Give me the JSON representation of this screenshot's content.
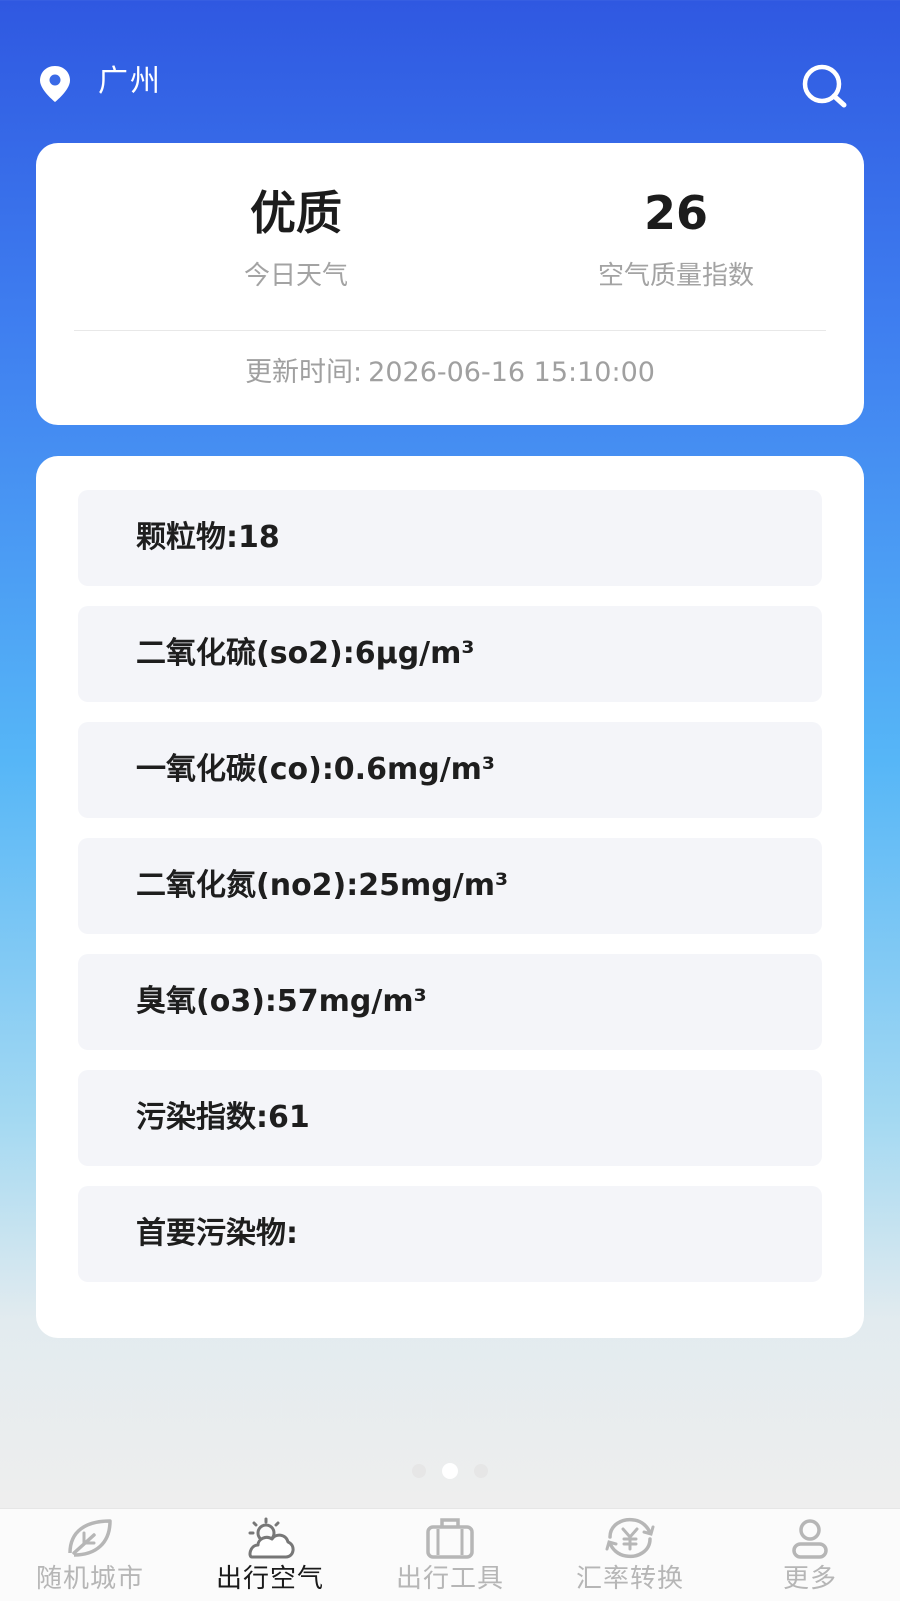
{
  "header": {
    "city": "广州",
    "location_icon": "location-pin-icon",
    "search_icon": "search-icon"
  },
  "summary": {
    "quality_value": "优质",
    "quality_label": "今日天气",
    "aqi_value": "26",
    "aqi_label": "空气质量指数",
    "updated_label": "更新时间:",
    "updated_time": "2026-06-16 15:10:00"
  },
  "details": [
    "颗粒物:18",
    "二氧化硫(so2):6μg/m³",
    "一氧化碳(co):0.6mg/m³",
    "二氧化氮(no2):25mg/m³",
    "臭氧(o3):57mg/m³",
    "污染指数:61",
    "首要污染物:"
  ],
  "pager": {
    "count": 3,
    "active_index": 1
  },
  "tabs": [
    {
      "label": "随机城市",
      "icon": "leaf-icon"
    },
    {
      "label": "出行空气",
      "icon": "sun-cloud-icon",
      "active": true
    },
    {
      "label": "出行工具",
      "icon": "suitcase-icon"
    },
    {
      "label": "汇率转换",
      "icon": "currency-exchange-icon"
    },
    {
      "label": "更多",
      "icon": "user-icon"
    }
  ],
  "colors": {
    "accent_top": "#2f58e1",
    "card_bg": "#ffffff",
    "row_bg": "#f4f5f9",
    "tab_active": "#1a1a1a",
    "tab_inactive": "#b6b6b6"
  }
}
